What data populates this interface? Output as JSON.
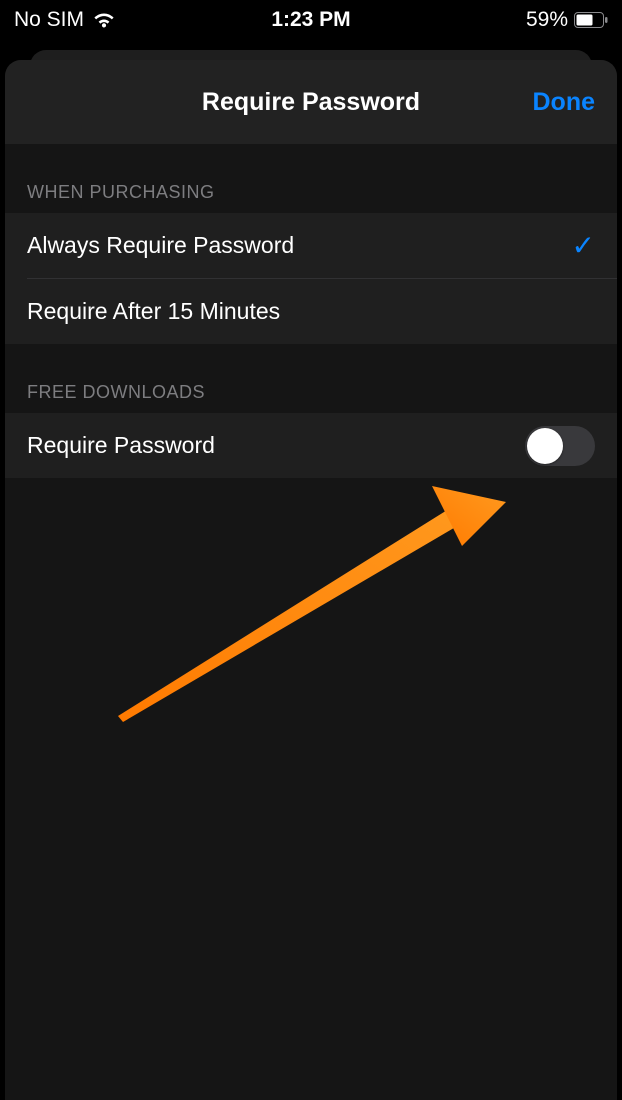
{
  "status": {
    "carrier": "No SIM",
    "time": "1:23 PM",
    "battery_pct": "59%"
  },
  "nav": {
    "title": "Require Password",
    "done": "Done"
  },
  "sections": {
    "purchasing_header": "WHEN PURCHASING",
    "purchasing_options": [
      {
        "label": "Always Require Password",
        "selected": true
      },
      {
        "label": "Require After 15 Minutes",
        "selected": false
      }
    ],
    "free_header": "FREE DOWNLOADS",
    "free_toggle_label": "Require Password",
    "free_toggle_on": false
  }
}
